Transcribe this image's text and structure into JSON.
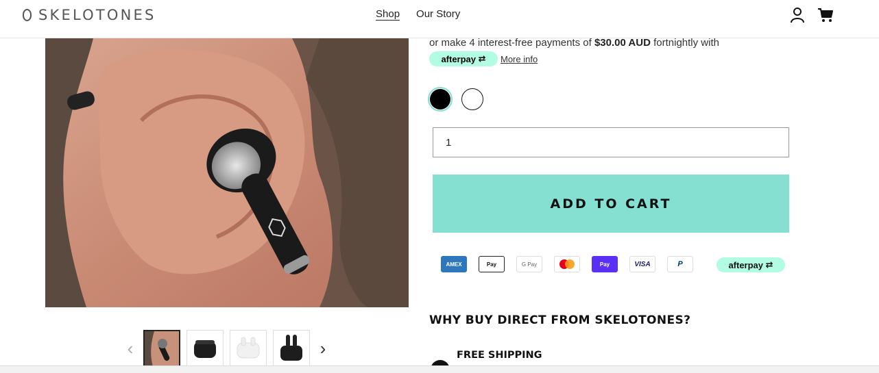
{
  "header": {
    "logo_text": "SKELOTONES",
    "nav": {
      "shop": "Shop",
      "our_story": "Our Story"
    },
    "icons": [
      "account-icon",
      "cart-icon"
    ]
  },
  "gallery": {
    "thumbnails": [
      "ear-photo",
      "black-case",
      "white-case",
      "black-case-open"
    ],
    "active_index": 0
  },
  "afterpay": {
    "line_prefix": "or make 4 interest-free payments of ",
    "amount": "$30.00 AUD",
    "line_suffix": " fortnightly with",
    "badge_label": "afterpay",
    "more_info": "More info"
  },
  "variants": {
    "colors": [
      "black",
      "white"
    ],
    "selected": "black"
  },
  "quantity": {
    "value": "1"
  },
  "add_to_cart": {
    "label": "ADD TO CART"
  },
  "payments": {
    "methods": [
      "AMEX",
      "Pay",
      "G Pay",
      "mastercard",
      "Pay",
      "VISA",
      "P"
    ],
    "afterpay_label": "afterpay"
  },
  "why": {
    "heading": "WHY BUY DIRECT FROM SKELOTONES?",
    "first_item": "FREE SHIPPING"
  },
  "colors": {
    "accent": "#85e0d1",
    "afterpay_mint": "#b2fce4"
  }
}
